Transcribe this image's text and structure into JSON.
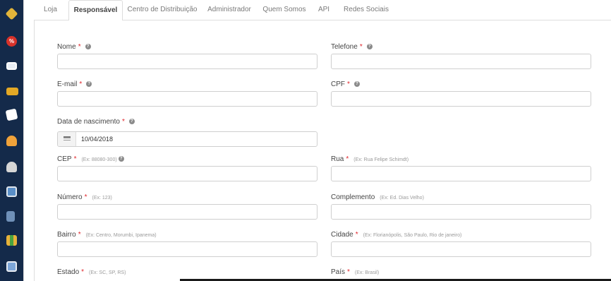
{
  "sidebar": {
    "icons": [
      "box-icon",
      "promo-icon",
      "card-icon",
      "truck-icon",
      "document-icon",
      "users-icon",
      "person-icon",
      "screen-icon",
      "phone-icon",
      "chart-icon",
      "image-icon"
    ]
  },
  "tabs": [
    {
      "label": "Loja"
    },
    {
      "label": "Responsável"
    },
    {
      "label": "Centro de Distribuição"
    },
    {
      "label": "Administrador"
    },
    {
      "label": "Quem Somos"
    },
    {
      "label": "API"
    },
    {
      "label": "Redes Sociais"
    }
  ],
  "active_tab": "Responsável",
  "form": {
    "nome": {
      "label": "Nome",
      "required": "*",
      "value": ""
    },
    "telefone": {
      "label": "Telefone",
      "required": "*",
      "value": ""
    },
    "email": {
      "label": "E-mail",
      "required": "*",
      "value": ""
    },
    "cpf": {
      "label": "CPF",
      "required": "*",
      "value": ""
    },
    "nascimento": {
      "label": "Data de nascimento",
      "required": "*",
      "value": "10/04/2018"
    },
    "cep": {
      "label": "CEP",
      "required": "*",
      "hint": "(Ex: 88080-300)",
      "value": ""
    },
    "rua": {
      "label": "Rua",
      "required": "*",
      "hint": "(Ex: Rua Felipe Schimdt)",
      "value": ""
    },
    "numero": {
      "label": "Número",
      "required": "*",
      "hint": "(Ex: 123)",
      "value": ""
    },
    "complemento": {
      "label": "Complemento",
      "hint": "(Ex: Ed. Dias Velho)",
      "value": ""
    },
    "bairro": {
      "label": "Bairro",
      "required": "*",
      "hint": "(Ex: Centro, Morumbi, Ipanema)",
      "value": ""
    },
    "cidade": {
      "label": "Cidade",
      "required": "*",
      "hint": "(Ex: Florianópolis, São Paulo, Rio de janeiro)",
      "value": ""
    },
    "estado": {
      "label": "Estado",
      "required": "*",
      "hint": "(Ex: SC, SP, RS)"
    },
    "pais": {
      "label": "País",
      "required": "*",
      "hint": "(Ex: Brasil)"
    }
  },
  "help_glyph": "?",
  "colors": {
    "sidebar": "#142a4a",
    "required": "#e0262c",
    "border": "#cfcfcf"
  }
}
